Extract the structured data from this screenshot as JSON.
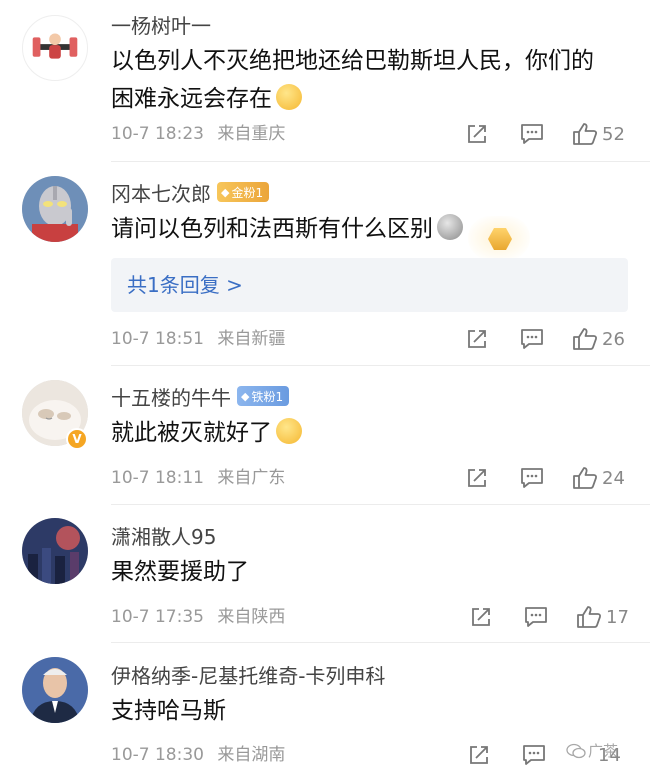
{
  "comments": [
    {
      "username": "一杨树叶一",
      "text_line1": "以色列人不灭绝把地还给巴勒斯坦人民，你们的",
      "text_line2": "困难永远会存在",
      "time": "10-7 18:23",
      "location": "来自重庆",
      "likes": "52"
    },
    {
      "username": "冈本七次郎",
      "badge": "金粉1",
      "text": "请问以色列和法西斯有什么区别",
      "reply_link": "共1条回复 >",
      "time": "10-7 18:51",
      "location": "来自新疆",
      "likes": "26"
    },
    {
      "username": "十五楼的牛牛",
      "badge": "铁粉1",
      "verified": "V",
      "text": "就此被灭就好了",
      "time": "10-7 18:11",
      "location": "来自广东",
      "likes": "24"
    },
    {
      "username": "潇湘散人95",
      "text": "果然要援助了",
      "time": "10-7 17:35",
      "location": "来自陕西",
      "likes": "17"
    },
    {
      "username": "伊格纳季-尼基托维奇-卡列申科",
      "text": "支持哈马斯",
      "time": "10-7 18:30",
      "location": "来自湖南",
      "likes": "14"
    }
  ],
  "watermark": "广茶",
  "colors": {
    "link": "#3a6ec4",
    "meta": "#999999",
    "gold_badge": "#eba53a",
    "iron_badge": "#6a9be0"
  },
  "icons": [
    "share-icon",
    "comment-icon",
    "like-icon"
  ]
}
